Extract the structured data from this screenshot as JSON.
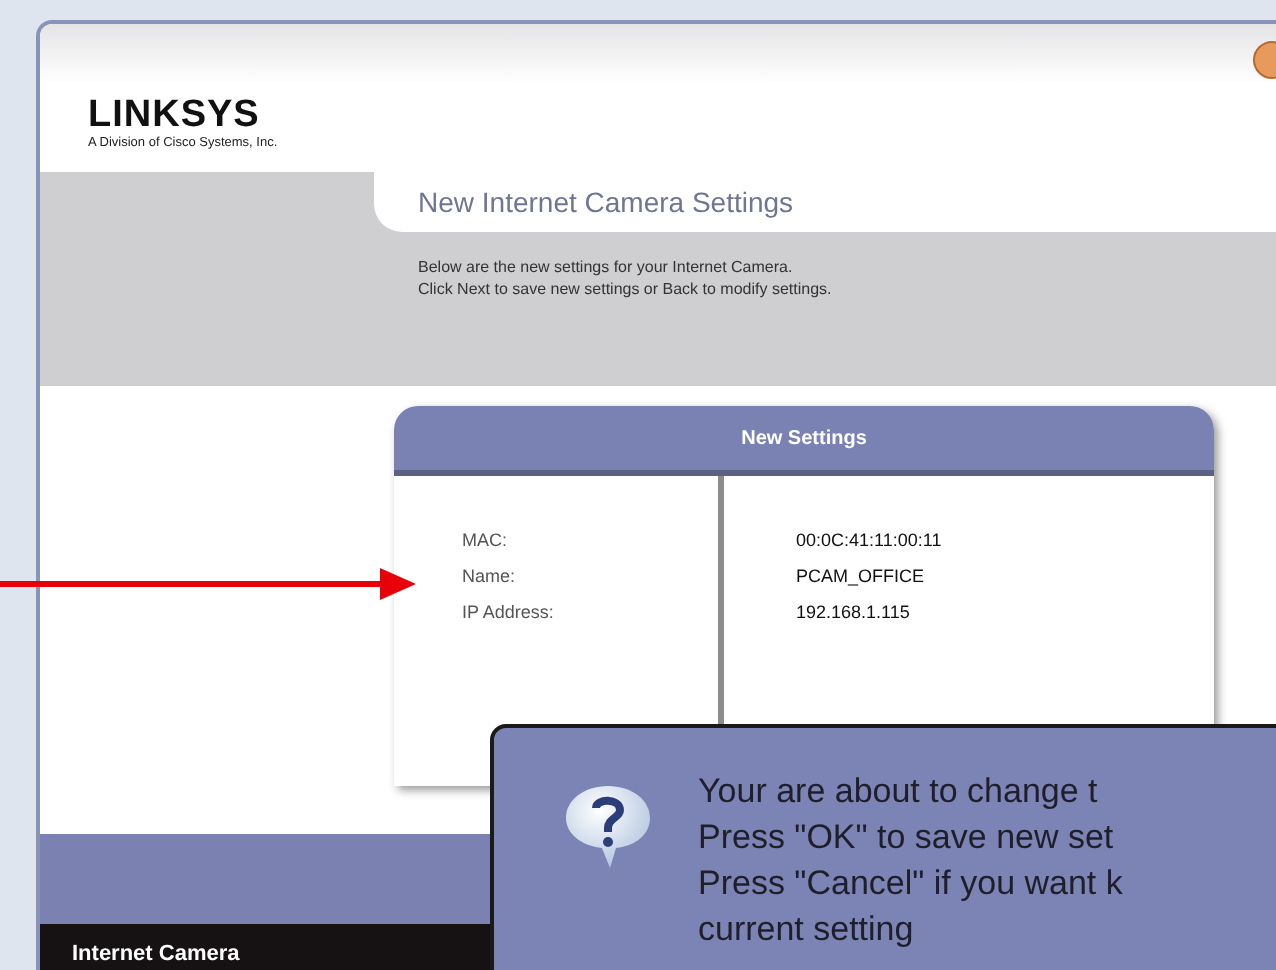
{
  "brand": {
    "logo": "LINKSYS",
    "tagline": "A Division of Cisco Systems, Inc."
  },
  "page": {
    "title": "New Internet Camera Settings",
    "description": [
      "Below are the new settings for your Internet Camera.",
      "Click Next to save new settings or Back to modify settings."
    ]
  },
  "settings_card": {
    "title": "New Settings",
    "rows": [
      {
        "label": "MAC:",
        "value": "00:0C:41:11:00:11"
      },
      {
        "label": "Name:",
        "value": "PCAM_OFFICE"
      },
      {
        "label": "IP Address:",
        "value": "192.168.1.115"
      }
    ]
  },
  "footer": {
    "product": "Internet Camera"
  },
  "dialog": {
    "lines": [
      "Your are about to change t",
      "Press \"OK\" to save new set",
      "Press \"Cancel\" if you want k",
      "current setting"
    ]
  }
}
